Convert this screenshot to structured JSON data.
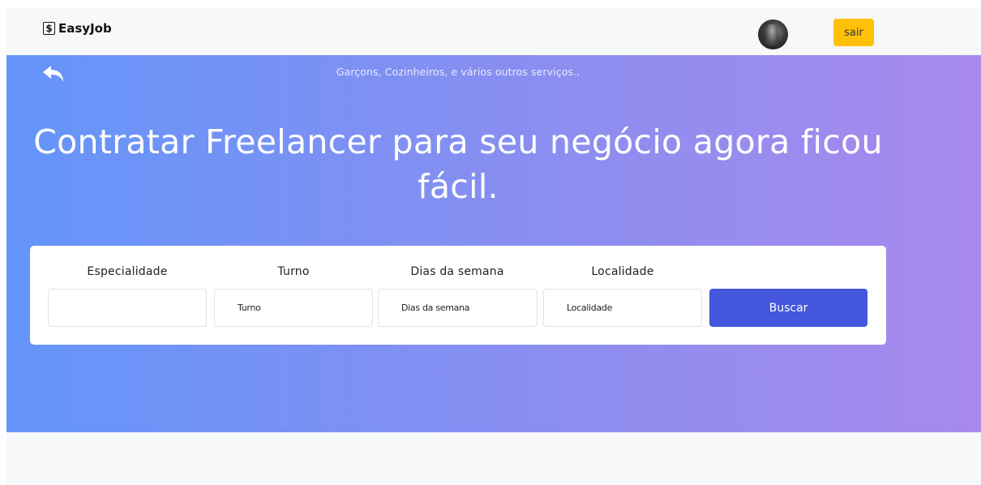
{
  "navbar": {
    "brand_symbol": "$",
    "brand_name": "EasyJob",
    "logout_label": "sair"
  },
  "hero": {
    "subtitle": "Garçons, Cozinheiros, e vários outros serviços..",
    "title": "Contratar Freelancer para seu negócio agora ficou fácil."
  },
  "search": {
    "specialty_label": "Especialidade",
    "specialty_value": "",
    "shift_label": "Turno",
    "shift_placeholder": "Turno",
    "days_label": "Dias da semana",
    "days_placeholder": "Dias da semana",
    "location_label": "Localidade",
    "location_placeholder": "Localidade",
    "submit_label": "Buscar"
  },
  "colors": {
    "logout_button": "#ffc107",
    "search_button": "#4356dc",
    "hero_gradient_start": "#6495fa",
    "hero_gradient_end": "#a889ec"
  },
  "icons": {
    "back": "reply-arrow-icon",
    "brand": "dollar-box-icon"
  }
}
